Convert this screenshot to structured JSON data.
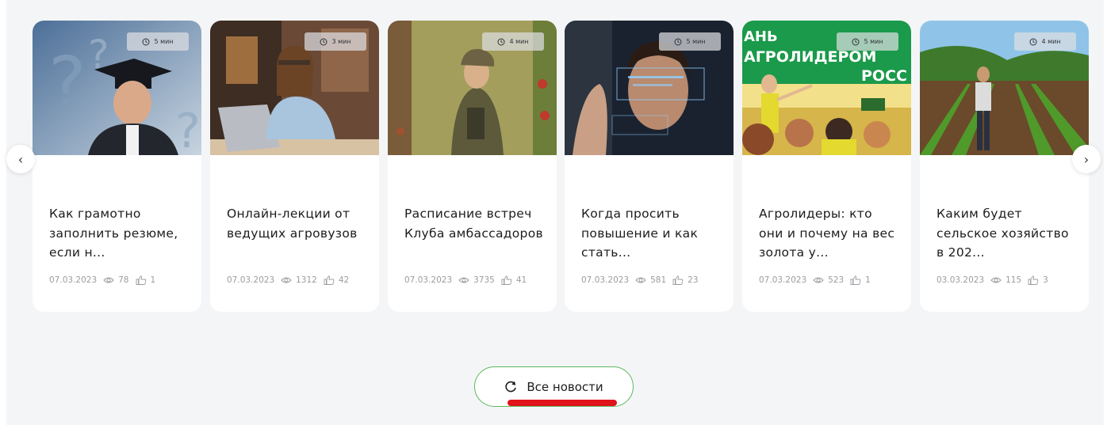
{
  "cards": [
    {
      "read_time": "5 мин",
      "title": "Как грамотно заполнить резюме, если н...",
      "date": "07.03.2023",
      "views": "78",
      "likes": "1"
    },
    {
      "read_time": "3 мин",
      "title": "Онлайн-лекции от ведущих агровузов",
      "date": "07.03.2023",
      "views": "1312",
      "likes": "42"
    },
    {
      "read_time": "4 мин",
      "title": "Расписание встреч Клуба амбассадоров",
      "date": "07.03.2023",
      "views": "3735",
      "likes": "41"
    },
    {
      "read_time": "5 мин",
      "title": "Когда просить повышение и как стать...",
      "date": "07.03.2023",
      "views": "581",
      "likes": "23"
    },
    {
      "read_time": "5 мин",
      "title": "Агролидеры: кто они и почему на вес золота у...",
      "date": "07.03.2023",
      "views": "523",
      "likes": "1"
    },
    {
      "read_time": "4 мин",
      "title": "Каким будет сельское хозяйство в 202...",
      "date": "03.03.2023",
      "views": "115",
      "likes": "3"
    }
  ],
  "image_texts": {
    "card5": [
      "АНЬ",
      "АГРОЛИДЕРОМ",
      "РОСС"
    ]
  },
  "nav": {
    "prev_icon": "chevron-left-icon",
    "next_icon": "chevron-right-icon",
    "prev": "‹",
    "next": "›"
  },
  "all_news": {
    "label": "Все новости",
    "icon": "refresh-icon"
  },
  "colors": {
    "accent": "#5cb85c",
    "underline": "#e0121a",
    "card_bg": "#ffffff",
    "panel_bg": "#f4f5f7"
  }
}
